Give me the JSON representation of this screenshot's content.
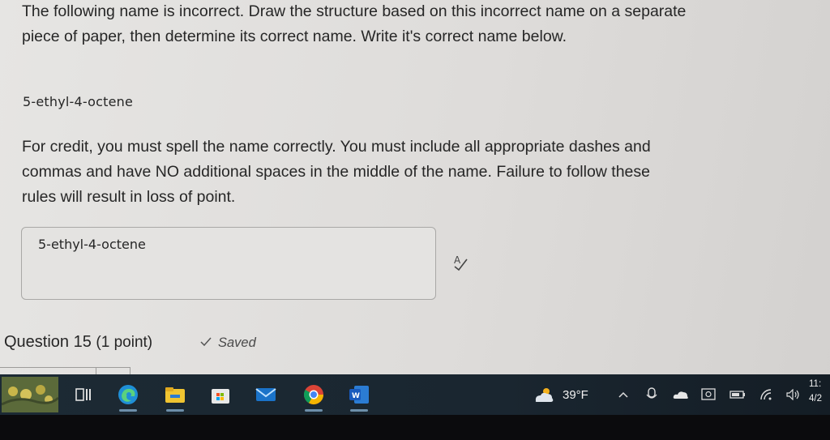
{
  "question": {
    "instruction": "The following name is incorrect. Draw the structure based on this incorrect name on a separate piece of paper, then determine its correct name. Write it's correct name below.",
    "given_name": "5-ethyl-4-octene",
    "rules": "For credit, you must spell the name correctly. You must include all appropriate dashes and commas and have NO additional spaces in the middle of the name. Failure to follow these rules will result in loss of point.",
    "answer_value": "5-ethyl-4-octene"
  },
  "next_question": {
    "label": "Question 15",
    "points": "(1 point)",
    "status": "Saved"
  },
  "taskbar": {
    "apps": [
      "widgets-icon",
      "task-view-icon",
      "edge-icon",
      "file-explorer-icon",
      "store-icon",
      "mail-icon",
      "chrome-icon",
      "word-icon"
    ],
    "weather_temp": "39°F",
    "clock_time": "11:",
    "clock_date": "4/2"
  },
  "colors": {
    "page_bg": "#e2e1df",
    "taskbar_bg": "#1c2a34",
    "text": "#262626"
  }
}
